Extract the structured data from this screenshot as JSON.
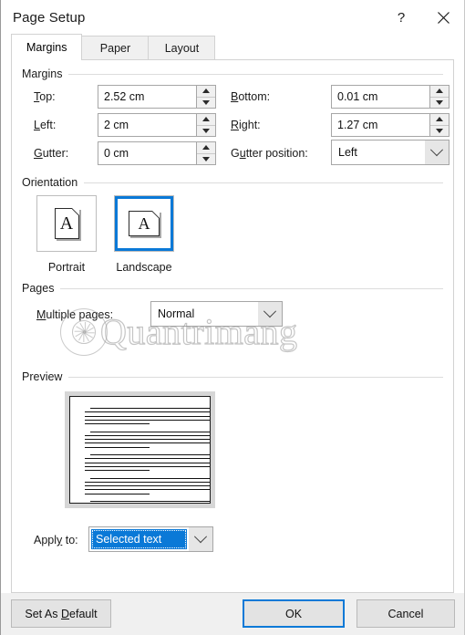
{
  "window": {
    "title": "Page Setup",
    "help_icon": "question-mark-icon",
    "close_icon": "close-icon"
  },
  "tabs": [
    {
      "label": "Margins",
      "active": true
    },
    {
      "label": "Paper",
      "active": false
    },
    {
      "label": "Layout",
      "active": false
    }
  ],
  "groups": {
    "margins": "Margins",
    "orientation": "Orientation",
    "pages": "Pages",
    "preview": "Preview"
  },
  "margins": {
    "top_label": "Top:",
    "top_value": "2.52 cm",
    "bottom_label": "Bottom:",
    "bottom_value": "0.01 cm",
    "left_label": "Left:",
    "left_value": "2 cm",
    "right_label": "Right:",
    "right_value": "1.27 cm",
    "gutter_label": "Gutter:",
    "gutter_value": "0 cm",
    "gutter_position_label": "Gutter position:",
    "gutter_position_value": "Left"
  },
  "orientation": {
    "portrait_label": "Portrait",
    "landscape_label": "Landscape",
    "selected": "Landscape",
    "glyph": "A"
  },
  "pages": {
    "multiple_label": "Multiple pages:",
    "multiple_value": "Normal"
  },
  "apply": {
    "label": "Apply to:",
    "value": "Selected text"
  },
  "footer": {
    "set_default": "Set As Default",
    "ok": "OK",
    "cancel": "Cancel"
  },
  "watermark": {
    "text": "Quantrimang"
  },
  "colors": {
    "accent": "#0a79d7",
    "selection": "#0a79d7",
    "dialog_bg": "#ffffff",
    "footer_bg": "#f0f0f0",
    "border": "#a6a6a6"
  }
}
